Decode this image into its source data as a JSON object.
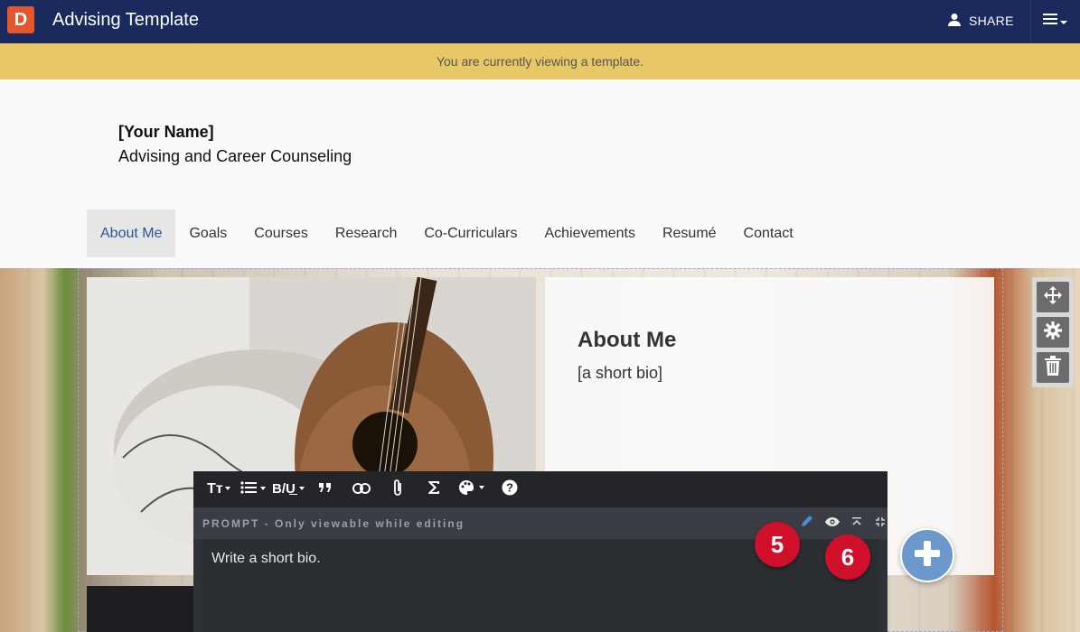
{
  "app": {
    "logo_letter": "D",
    "title": "Advising Template",
    "share_label": "SHARE"
  },
  "banner": {
    "text": "You are currently viewing a template."
  },
  "header": {
    "name": "[Your Name]",
    "subtitle": "Advising and Career Counseling"
  },
  "nav": {
    "items": [
      {
        "label": "About Me",
        "active": true
      },
      {
        "label": "Goals"
      },
      {
        "label": "Courses"
      },
      {
        "label": "Research"
      },
      {
        "label": "Co-Curriculars"
      },
      {
        "label": "Achievements"
      },
      {
        "label": "Resumé"
      },
      {
        "label": "Contact"
      }
    ]
  },
  "about": {
    "title": "About Me",
    "bio": "[a short bio]"
  },
  "editor": {
    "prompt_label": "PROMPT - Only viewable while editing",
    "prompt_text": "Write a short bio."
  },
  "badges": {
    "first": "5",
    "second": "6"
  },
  "colors": {
    "topbar": "#1b2a5c",
    "banner": "#e8c866",
    "accent": "#2b5797",
    "badge": "#d0102a",
    "add_button": "#6d98cc"
  }
}
